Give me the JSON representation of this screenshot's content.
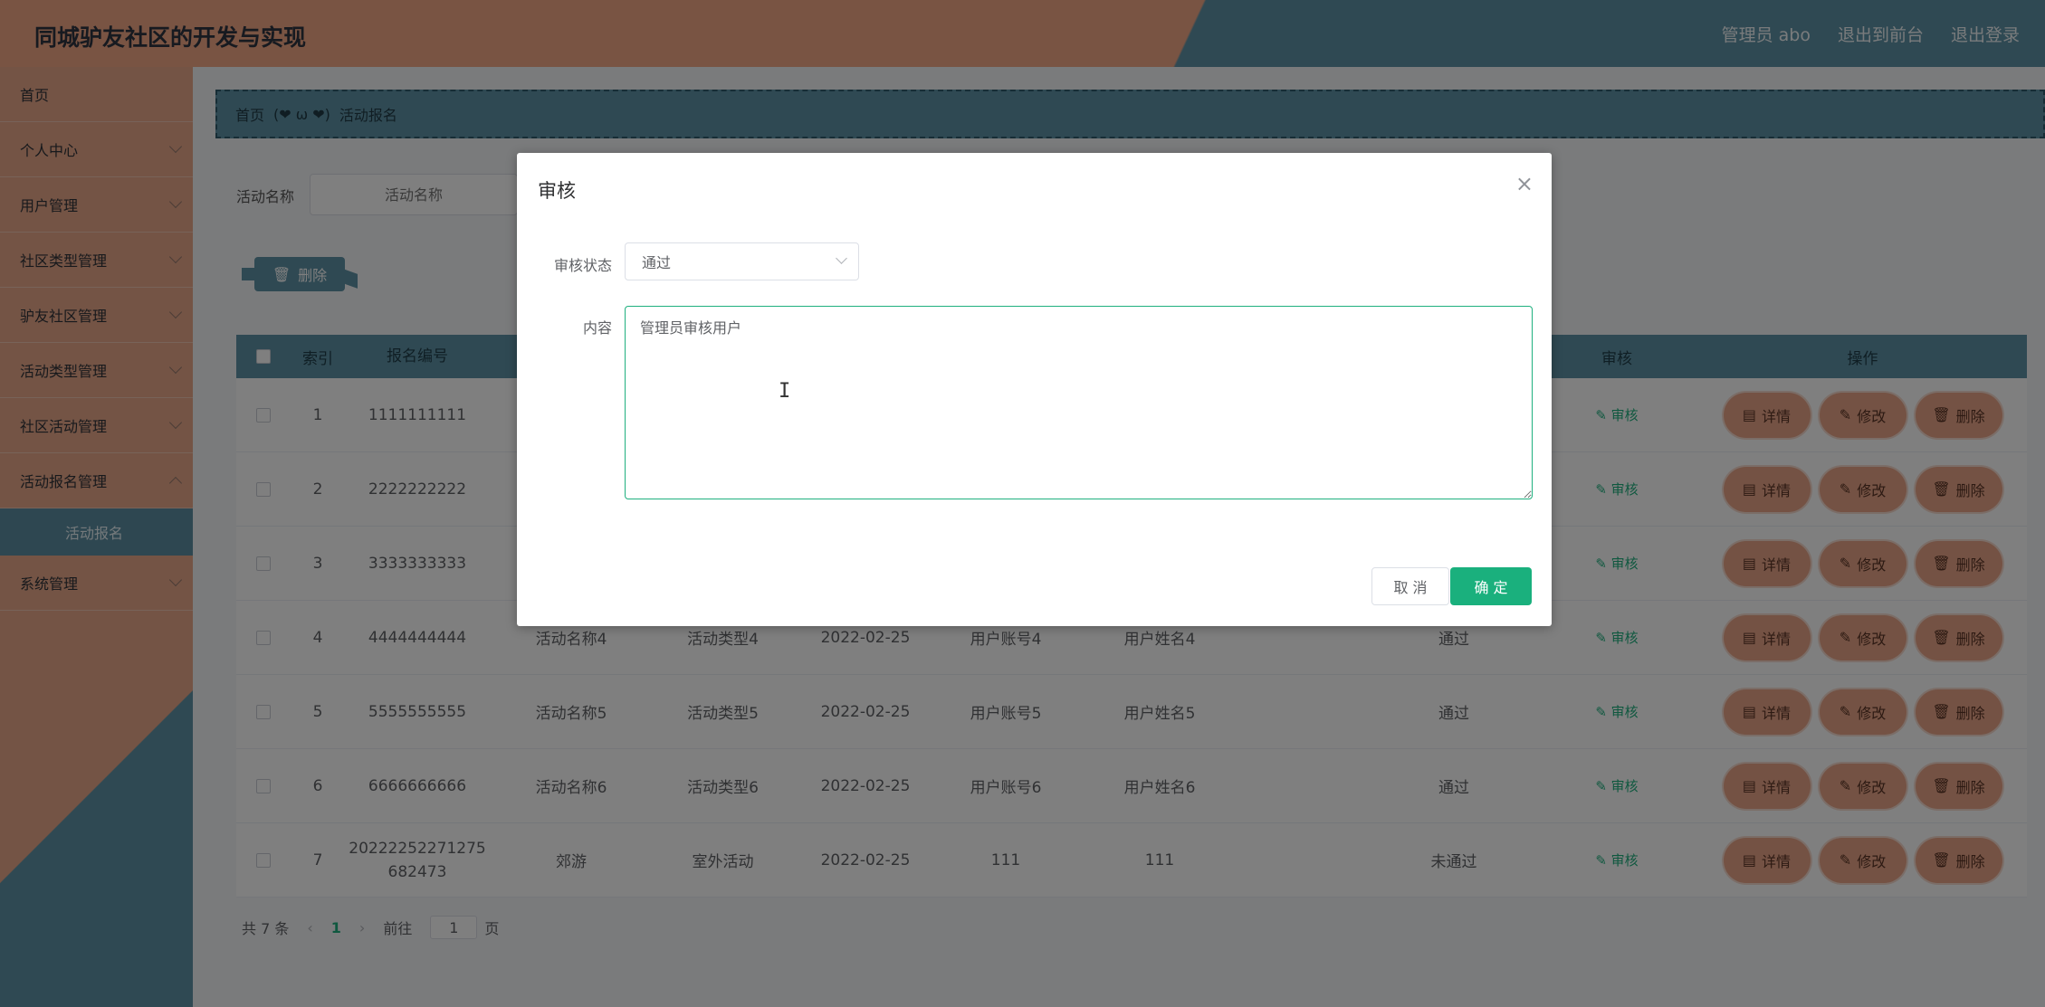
{
  "header": {
    "title": "同城驴友社区的开发与实现",
    "admin_label": "管理员 abo",
    "frontend_link": "退出到前台",
    "logout_link": "退出登录"
  },
  "sidebar": {
    "items": [
      {
        "label": "首页"
      },
      {
        "label": "个人中心"
      },
      {
        "label": "用户管理"
      },
      {
        "label": "社区类型管理"
      },
      {
        "label": "驴友社区管理"
      },
      {
        "label": "活动类型管理"
      },
      {
        "label": "社区活动管理"
      },
      {
        "label": "活动报名管理"
      }
    ],
    "sub_item": "活动报名",
    "last_item": "系统管理"
  },
  "breadcrumb": {
    "home": "首页",
    "separator": "(❤ ω ❤)",
    "current": "活动报名"
  },
  "filter": {
    "label": "活动名称",
    "placeholder": "活动名称"
  },
  "toolbar": {
    "delete_label": "删除"
  },
  "table": {
    "headers": {
      "index": "索引",
      "number": "报名编号",
      "audit": "审核",
      "ops": "操作"
    },
    "rows": [
      {
        "index": "1",
        "number": "1111111111",
        "name": "",
        "type": "",
        "date": "",
        "account": "",
        "username": "",
        "status": ""
      },
      {
        "index": "2",
        "number": "2222222222",
        "name": "",
        "type": "",
        "date": "",
        "account": "",
        "username": "",
        "status": ""
      },
      {
        "index": "3",
        "number": "3333333333",
        "name": "",
        "type": "",
        "date": "",
        "account": "",
        "username": "",
        "status": ""
      },
      {
        "index": "4",
        "number": "4444444444",
        "name": "活动名称4",
        "type": "活动类型4",
        "date": "2022-02-25",
        "account": "用户账号4",
        "username": "用户姓名4",
        "status": "通过"
      },
      {
        "index": "5",
        "number": "5555555555",
        "name": "活动名称5",
        "type": "活动类型5",
        "date": "2022-02-25",
        "account": "用户账号5",
        "username": "用户姓名5",
        "status": "通过"
      },
      {
        "index": "6",
        "number": "6666666666",
        "name": "活动名称6",
        "type": "活动类型6",
        "date": "2022-02-25",
        "account": "用户账号6",
        "username": "用户姓名6",
        "status": "通过"
      },
      {
        "index": "7",
        "number": "20222252271275682473",
        "number_line1": "20222252271275",
        "number_line2": "682473",
        "name": "郊游",
        "type": "室外活动",
        "date": "2022-02-25",
        "account": "111",
        "username": "111",
        "status": "未通过"
      }
    ],
    "audit_link": "审核",
    "op_detail": "详情",
    "op_edit": "修改",
    "op_delete": "删除"
  },
  "pager": {
    "total": "共 7 条",
    "current": "1",
    "goto_prefix": "前往",
    "goto_value": "1",
    "goto_suffix": "页"
  },
  "dialog": {
    "title": "审核",
    "status_label": "审核状态",
    "status_value": "通过",
    "content_label": "内容",
    "content_value": "管理员审核用户",
    "cancel_label": "取 消",
    "ok_label": "确 定"
  },
  "colors": {
    "accent_green": "#1ab07d",
    "brand_orange": "#e9a88b",
    "brand_teal": "#5f93a6"
  }
}
